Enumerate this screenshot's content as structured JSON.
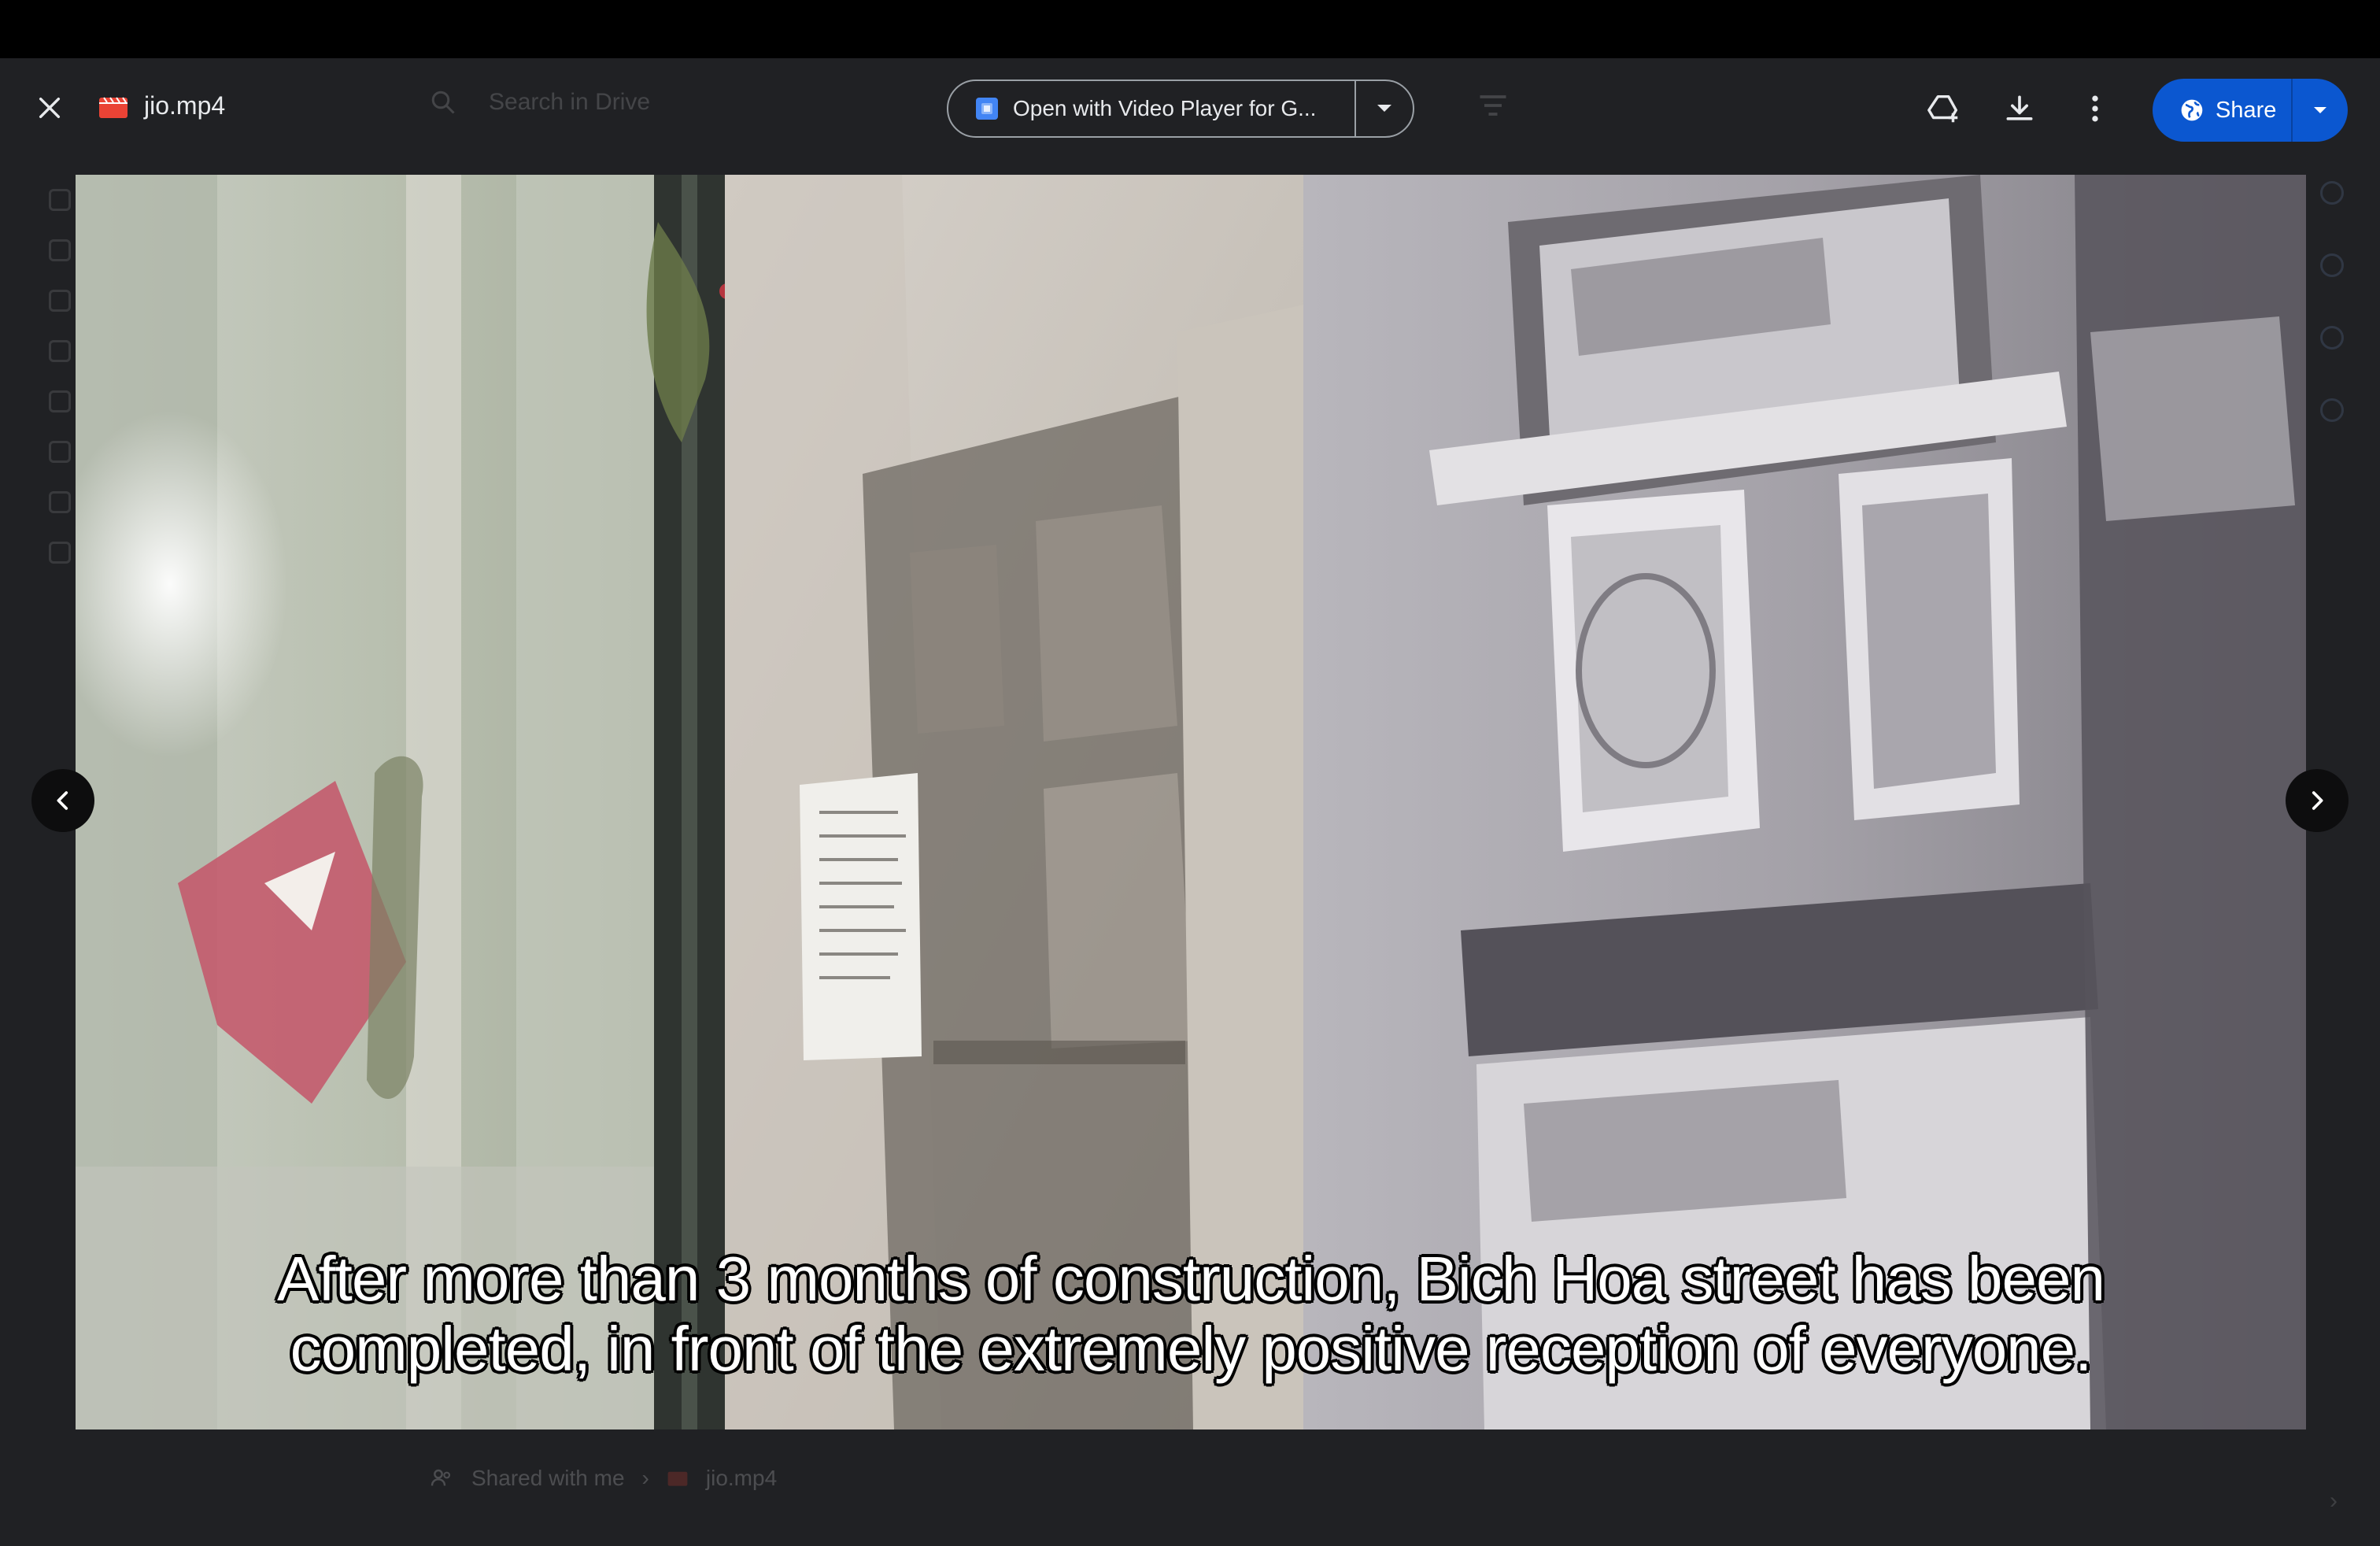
{
  "viewer": {
    "file_name": "jio.mp4",
    "open_with_label": "Open with Video Player for G...",
    "share_label": "Share"
  },
  "background": {
    "search_placeholder": "Search in Drive",
    "breadcrumb": [
      "Shared with me",
      "jio.mp4"
    ]
  },
  "video": {
    "subtitle_line1": "After more than 3 months of construction, Bich Hoa street has been",
    "subtitle_line2": "completed, in front of the extremely positive reception of everyone."
  },
  "colors": {
    "share_blue": "#0b57d0",
    "file_icon_red": "#ea4335",
    "app_icon_blue": "#4285f4"
  },
  "icons": {
    "close": "close-icon",
    "file": "video-file-icon",
    "add_to_drive": "add-to-drive-icon",
    "download": "download-icon",
    "more": "more-vert-icon",
    "share": "globe-icon",
    "prev": "chevron-left-icon",
    "next": "chevron-right-icon"
  }
}
